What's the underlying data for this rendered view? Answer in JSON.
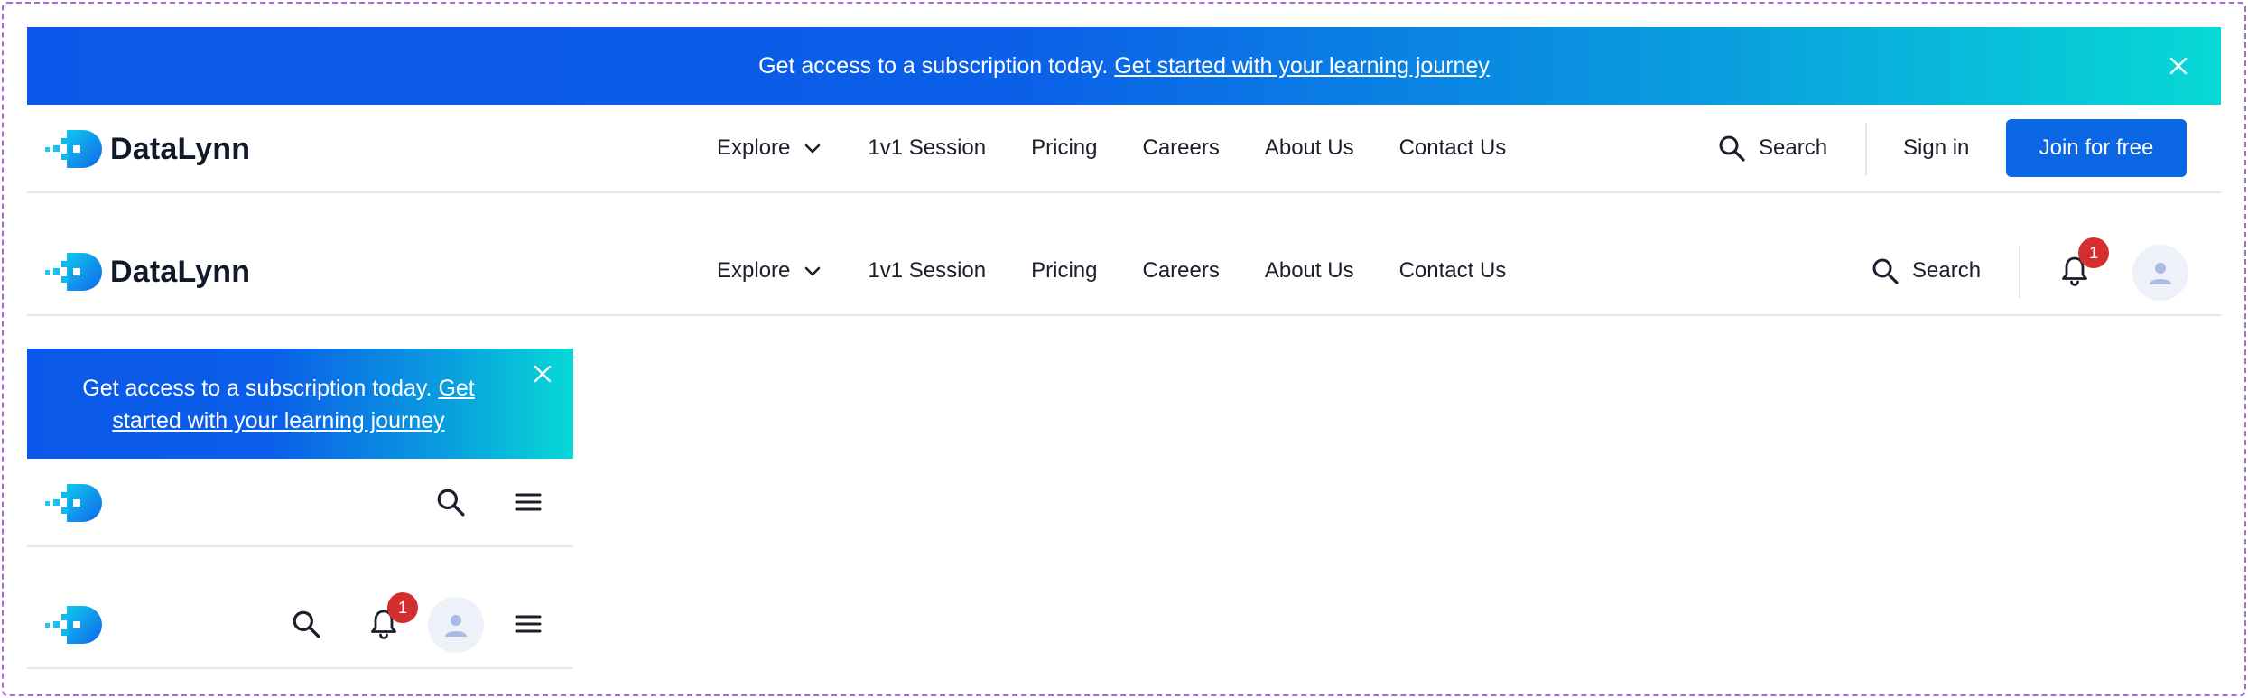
{
  "banner": {
    "text": "Get access to a subscription today.",
    "link": "Get started with your learning journey",
    "mobile_link_line1": "Get",
    "mobile_link_line2": "started with your learning journey"
  },
  "brand": {
    "name": "DataLynn"
  },
  "nav": {
    "items": [
      {
        "label": "Explore",
        "has_dropdown": true
      },
      {
        "label": "1v1 Session"
      },
      {
        "label": "Pricing"
      },
      {
        "label": "Careers"
      },
      {
        "label": "About Us"
      },
      {
        "label": "Contact Us"
      }
    ],
    "search_label": "Search",
    "signin_label": "Sign in",
    "join_label": "Join for free",
    "notification_count": "1"
  },
  "icons": [
    "close-icon",
    "search-icon",
    "chevron-down-icon",
    "bell-icon",
    "user-icon",
    "menu-icon"
  ],
  "colors": {
    "primary": "#0b66e4",
    "banner_gradient_start": "#0b57e9",
    "banner_gradient_end": "#07d9d6",
    "badge": "#d32f2f",
    "avatar_bg": "#eef1f7"
  }
}
